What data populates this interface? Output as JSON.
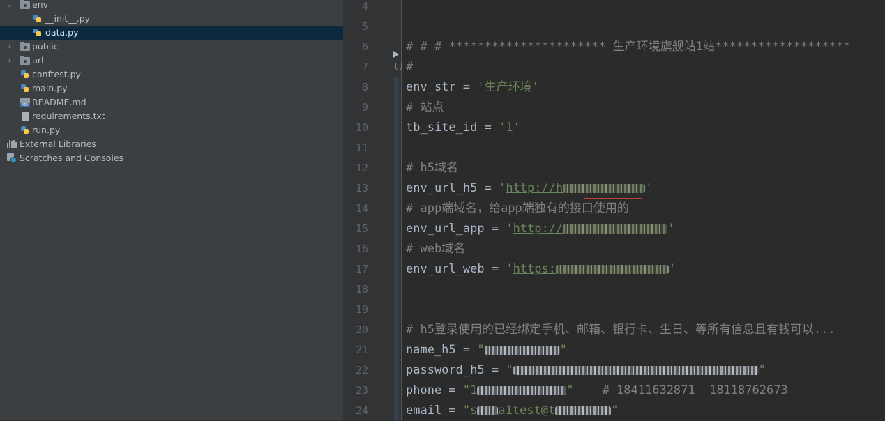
{
  "project_tree": {
    "items": [
      {
        "label": "env",
        "type": "folder",
        "expanded": true,
        "depth": 0
      },
      {
        "label": "__init__.py",
        "type": "python",
        "depth": 1
      },
      {
        "label": "data.py",
        "type": "python",
        "depth": 1,
        "selected": true
      },
      {
        "label": "public",
        "type": "folder",
        "expanded": false,
        "depth": 0
      },
      {
        "label": "url",
        "type": "folder",
        "expanded": false,
        "depth": 0
      },
      {
        "label": "conftest.py",
        "type": "python",
        "depth": 0
      },
      {
        "label": "main.py",
        "type": "python",
        "depth": 0
      },
      {
        "label": "README.md",
        "type": "markdown",
        "depth": 0
      },
      {
        "label": "requirements.txt",
        "type": "text",
        "depth": 0
      },
      {
        "label": "run.py",
        "type": "python",
        "depth": 0
      },
      {
        "label": "External Libraries",
        "type": "libraries",
        "depth": -1
      },
      {
        "label": "Scratches and Consoles",
        "type": "scratches",
        "depth": -1
      }
    ]
  },
  "editor": {
    "line_numbers": [
      "4",
      "5",
      "6",
      "7",
      "8",
      "9",
      "10",
      "11",
      "12",
      "13",
      "14",
      "15",
      "16",
      "17",
      "18",
      "19",
      "20",
      "21",
      "22",
      "23",
      "24"
    ],
    "lines": {
      "l6": "# # # ********************** 生产环境旗舰站1站*******************",
      "l7": "#",
      "l8_var": "env_str",
      "l8_op": " = ",
      "l8_str": "'生产环境'",
      "l9": "# 站点",
      "l10_var": "tb_site_id",
      "l10_op": " = ",
      "l10_str": "'1'",
      "l12": "# h5域名",
      "l13_var": "env_url_h5",
      "l13_op": " = ",
      "l13_q": "'",
      "l13_url": "http://h",
      "l13_end": "'",
      "l14": "# app端域名，给app端独有的接口使用的",
      "l15_var": "env_url_app",
      "l15_op": " = ",
      "l15_q": "'",
      "l15_url": "http://",
      "l15_end": "'",
      "l16": "# web域名",
      "l17_var": "env_url_web",
      "l17_op": " = ",
      "l17_q": "'",
      "l17_url": "https:",
      "l17_end": "'",
      "l20": "# h5登录使用的已经绑定手机、邮箱、银行卡、生日、等所有信息且有钱可以...",
      "l21_var": "name_h5",
      "l21_op": " = ",
      "l21_q": "\"",
      "l21_end": "\"",
      "l22_var": "password_h5",
      "l22_op": " = ",
      "l22_q": "\"",
      "l22_end": "\"",
      "l23_var": "phone",
      "l23_op": " = ",
      "l23_q": "\"1",
      "l23_end": "\"",
      "l23_comment": "    # 18411632871  18118762673",
      "l24_var": "email",
      "l24_op": " = ",
      "l24_q": "\"s",
      "l24_mid": "a1test@t",
      "l24_end": "\""
    }
  }
}
